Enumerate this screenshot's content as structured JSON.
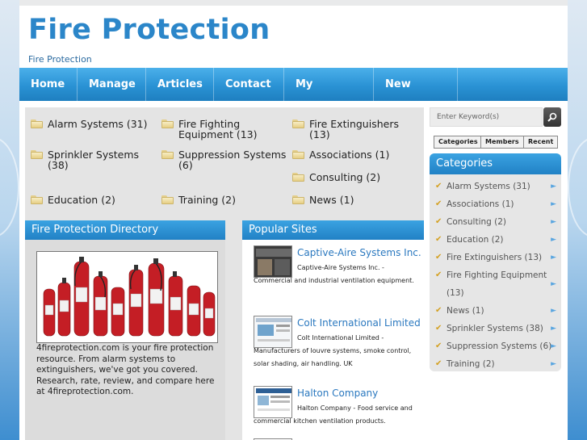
{
  "header": {
    "title": "Fire Protection",
    "tagline": "Fire Protection"
  },
  "nav": {
    "items": [
      "Home",
      "Manage",
      "Articles",
      "Contact",
      "My Account",
      "New Posts"
    ]
  },
  "categories": [
    {
      "label": "Alarm Systems (31)"
    },
    {
      "label": "Fire Fighting Equipment (13)"
    },
    {
      "label": "Fire Extinguishers (13)"
    },
    {
      "label": "Sprinkler Systems (38)"
    },
    {
      "label": "Suppression Systems (6)"
    },
    {
      "label": "Associations (1)"
    },
    {
      "label": "Consulting (2)"
    },
    {
      "label": "Education (2)"
    },
    {
      "label": "Training (2)"
    },
    {
      "label": "News (1)"
    }
  ],
  "directory": {
    "heading": "Fire Protection Directory",
    "text": "4fireprotection.com is your fire protection resource. From alarm systems to extinguishers, we've got you covered. Research, rate, review, and compare here at 4fireprotection.com."
  },
  "popular": {
    "heading": "Popular Sites",
    "sites": [
      {
        "name": "Captive-Aire Systems Inc.",
        "desc": "Captive-Aire Systems Inc. - Commercial and industrial ventilation equipment."
      },
      {
        "name": "Colt International Limited",
        "desc": "Colt International Limited - Manufacturers of louvre systems, smoke control, solar shading, air handling. UK"
      },
      {
        "name": "Halton Company",
        "desc": "Halton Company - Food service and commercial kitchen ventilation products."
      }
    ]
  },
  "sidebar": {
    "search_placeholder": "Enter Keyword(s)",
    "tabs": [
      "Categories",
      "Members",
      "Recent"
    ],
    "heading": "Categories",
    "items": [
      "Alarm Systems (31)",
      "Associations (1)",
      "Consulting (2)",
      "Education (2)",
      "Fire Extinguishers (13)",
      "Fire Fighting Equipment (13)",
      "News (1)",
      "Sprinkler Systems (38)",
      "Suppression Systems (6)",
      "Training (2)"
    ]
  },
  "colors": {
    "accent": "#2b86c9",
    "nav": "#2a92d4",
    "check": "#d4a020"
  }
}
